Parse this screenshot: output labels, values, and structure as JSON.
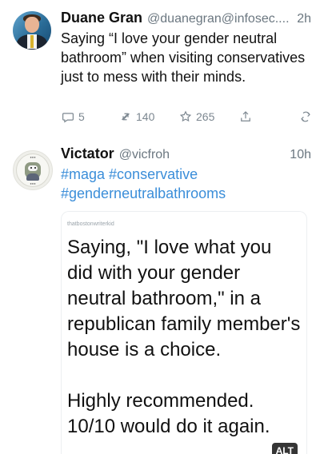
{
  "posts": [
    {
      "author": {
        "name": "Duane Gran",
        "handle": "@duanegran@infosec...."
      },
      "time": "2h",
      "text": "Saying “I love your gender neutral bathroom” when visiting conservatives just to mess with their minds.",
      "stats": {
        "replies": "5",
        "boosts": "140",
        "likes": "265"
      },
      "icons": {
        "avatar": "user-photo-avatar",
        "reply": "reply-icon",
        "boost": "boost-icon",
        "like": "star-icon",
        "share": "share-icon",
        "more": "more-icon"
      }
    },
    {
      "author": {
        "name": "Victator",
        "handle": "@vicfroh"
      },
      "time": "10h",
      "hashtags": "#maga #conservative #genderneutralbathrooms",
      "media": {
        "credit": "thatbostonwriterkid",
        "quote_paragraphs": [
          "Saying, \"I love what you did with your gender neutral bathroom,\" in a republican family member's house is a choice.",
          "Highly recommended. 10/10 would do it again."
        ],
        "alt_label": "ALT"
      },
      "icons": {
        "avatar": "badge-avatar"
      }
    }
  ]
}
